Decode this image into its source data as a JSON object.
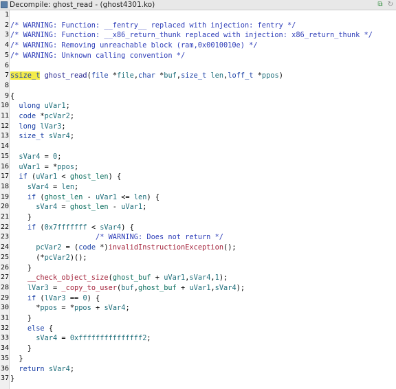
{
  "window": {
    "title": "Decompile: ghost_read -  (ghost4301.ko)"
  },
  "toolbar": {
    "copy_icon": "copy-icon",
    "refresh_icon": "refresh-icon"
  },
  "lines": [
    {
      "n": "1",
      "tokens": []
    },
    {
      "n": "2",
      "tokens": [
        {
          "c": "cm",
          "t": "/* WARNING: Function: __fentry__ replaced with injection: fentry */"
        }
      ]
    },
    {
      "n": "3",
      "tokens": [
        {
          "c": "cm",
          "t": "/* WARNING: Function: __x86_return_thunk replaced with injection: x86_return_thunk */"
        }
      ]
    },
    {
      "n": "4",
      "tokens": [
        {
          "c": "cm",
          "t": "/* WARNING: Removing unreachable block (ram,0x0010010e) */"
        }
      ]
    },
    {
      "n": "5",
      "tokens": [
        {
          "c": "cm",
          "t": "/* WARNING: Unknown calling convention */"
        }
      ]
    },
    {
      "n": "6",
      "tokens": []
    },
    {
      "n": "7",
      "tokens": [
        {
          "c": "tp hl",
          "t": "ssize_t"
        },
        {
          "c": "",
          "t": " "
        },
        {
          "c": "fn",
          "t": "ghost_read"
        },
        {
          "c": "",
          "t": "("
        },
        {
          "c": "tp",
          "t": "file"
        },
        {
          "c": "",
          "t": " *"
        },
        {
          "c": "vr",
          "t": "file"
        },
        {
          "c": "",
          "t": ","
        },
        {
          "c": "tp",
          "t": "char"
        },
        {
          "c": "",
          "t": " *"
        },
        {
          "c": "vr",
          "t": "buf"
        },
        {
          "c": "",
          "t": ","
        },
        {
          "c": "tp",
          "t": "size_t"
        },
        {
          "c": "",
          "t": " "
        },
        {
          "c": "vr",
          "t": "len"
        },
        {
          "c": "",
          "t": ","
        },
        {
          "c": "tp",
          "t": "loff_t"
        },
        {
          "c": "",
          "t": " *"
        },
        {
          "c": "vr",
          "t": "ppos"
        },
        {
          "c": "",
          "t": ")"
        }
      ]
    },
    {
      "n": "8",
      "tokens": []
    },
    {
      "n": "9",
      "tokens": [
        {
          "c": "",
          "t": "{"
        }
      ]
    },
    {
      "n": "10",
      "tokens": [
        {
          "c": "",
          "t": "  "
        },
        {
          "c": "tp",
          "t": "ulong"
        },
        {
          "c": "",
          "t": " "
        },
        {
          "c": "vr",
          "t": "uVar1"
        },
        {
          "c": "",
          "t": ";"
        }
      ]
    },
    {
      "n": "11",
      "tokens": [
        {
          "c": "",
          "t": "  "
        },
        {
          "c": "tp",
          "t": "code"
        },
        {
          "c": "",
          "t": " *"
        },
        {
          "c": "vr",
          "t": "pcVar2"
        },
        {
          "c": "",
          "t": ";"
        }
      ]
    },
    {
      "n": "12",
      "tokens": [
        {
          "c": "",
          "t": "  "
        },
        {
          "c": "tp",
          "t": "long"
        },
        {
          "c": "",
          "t": " "
        },
        {
          "c": "vr",
          "t": "lVar3"
        },
        {
          "c": "",
          "t": ";"
        }
      ]
    },
    {
      "n": "13",
      "tokens": [
        {
          "c": "",
          "t": "  "
        },
        {
          "c": "tp",
          "t": "size_t"
        },
        {
          "c": "",
          "t": " "
        },
        {
          "c": "vr",
          "t": "sVar4"
        },
        {
          "c": "",
          "t": ";"
        }
      ]
    },
    {
      "n": "14",
      "tokens": []
    },
    {
      "n": "15",
      "tokens": [
        {
          "c": "",
          "t": "  "
        },
        {
          "c": "vr",
          "t": "sVar4"
        },
        {
          "c": "",
          "t": " = "
        },
        {
          "c": "nm",
          "t": "0"
        },
        {
          "c": "",
          "t": ";"
        }
      ]
    },
    {
      "n": "16",
      "tokens": [
        {
          "c": "",
          "t": "  "
        },
        {
          "c": "vr",
          "t": "uVar1"
        },
        {
          "c": "",
          "t": " = *"
        },
        {
          "c": "vr",
          "t": "ppos"
        },
        {
          "c": "",
          "t": ";"
        }
      ]
    },
    {
      "n": "17",
      "tokens": [
        {
          "c": "",
          "t": "  "
        },
        {
          "c": "kw",
          "t": "if"
        },
        {
          "c": "",
          "t": " ("
        },
        {
          "c": "vr",
          "t": "uVar1"
        },
        {
          "c": "",
          "t": " < "
        },
        {
          "c": "gl",
          "t": "ghost_len"
        },
        {
          "c": "",
          "t": ") {"
        }
      ]
    },
    {
      "n": "18",
      "tokens": [
        {
          "c": "",
          "t": "    "
        },
        {
          "c": "vr",
          "t": "sVar4"
        },
        {
          "c": "",
          "t": " = "
        },
        {
          "c": "vr",
          "t": "len"
        },
        {
          "c": "",
          "t": ";"
        }
      ]
    },
    {
      "n": "19",
      "tokens": [
        {
          "c": "",
          "t": "    "
        },
        {
          "c": "kw",
          "t": "if"
        },
        {
          "c": "",
          "t": " ("
        },
        {
          "c": "gl",
          "t": "ghost_len"
        },
        {
          "c": "",
          "t": " - "
        },
        {
          "c": "vr",
          "t": "uVar1"
        },
        {
          "c": "",
          "t": " <= "
        },
        {
          "c": "vr",
          "t": "len"
        },
        {
          "c": "",
          "t": ") {"
        }
      ]
    },
    {
      "n": "20",
      "tokens": [
        {
          "c": "",
          "t": "      "
        },
        {
          "c": "vr",
          "t": "sVar4"
        },
        {
          "c": "",
          "t": " = "
        },
        {
          "c": "gl",
          "t": "ghost_len"
        },
        {
          "c": "",
          "t": " - "
        },
        {
          "c": "vr",
          "t": "uVar1"
        },
        {
          "c": "",
          "t": ";"
        }
      ]
    },
    {
      "n": "21",
      "tokens": [
        {
          "c": "",
          "t": "    }"
        }
      ]
    },
    {
      "n": "22",
      "tokens": [
        {
          "c": "",
          "t": "    "
        },
        {
          "c": "kw",
          "t": "if"
        },
        {
          "c": "",
          "t": " ("
        },
        {
          "c": "nm",
          "t": "0x7fffffff"
        },
        {
          "c": "",
          "t": " < "
        },
        {
          "c": "vr",
          "t": "sVar4"
        },
        {
          "c": "",
          "t": ") {"
        }
      ]
    },
    {
      "n": "23",
      "tokens": [
        {
          "c": "",
          "t": "                    "
        },
        {
          "c": "cm",
          "t": "/* WARNING: Does not return */"
        }
      ]
    },
    {
      "n": "24",
      "tokens": [
        {
          "c": "",
          "t": "      "
        },
        {
          "c": "vr",
          "t": "pcVar2"
        },
        {
          "c": "",
          "t": " = ("
        },
        {
          "c": "tp",
          "t": "code"
        },
        {
          "c": "",
          "t": " *)"
        },
        {
          "c": "call",
          "t": "invalidInstructionException"
        },
        {
          "c": "",
          "t": "();"
        }
      ]
    },
    {
      "n": "25",
      "tokens": [
        {
          "c": "",
          "t": "      (*"
        },
        {
          "c": "vr",
          "t": "pcVar2"
        },
        {
          "c": "",
          "t": ")();"
        }
      ]
    },
    {
      "n": "26",
      "tokens": [
        {
          "c": "",
          "t": "    }"
        }
      ]
    },
    {
      "n": "27",
      "tokens": [
        {
          "c": "",
          "t": "    "
        },
        {
          "c": "call",
          "t": "__check_object_size"
        },
        {
          "c": "",
          "t": "("
        },
        {
          "c": "gl",
          "t": "ghost_buf"
        },
        {
          "c": "",
          "t": " + "
        },
        {
          "c": "vr",
          "t": "uVar1"
        },
        {
          "c": "",
          "t": ","
        },
        {
          "c": "vr",
          "t": "sVar4"
        },
        {
          "c": "",
          "t": ","
        },
        {
          "c": "nm",
          "t": "1"
        },
        {
          "c": "",
          "t": ");"
        }
      ]
    },
    {
      "n": "28",
      "tokens": [
        {
          "c": "",
          "t": "    "
        },
        {
          "c": "vr",
          "t": "lVar3"
        },
        {
          "c": "",
          "t": " = "
        },
        {
          "c": "call",
          "t": "_copy_to_user"
        },
        {
          "c": "",
          "t": "("
        },
        {
          "c": "vr",
          "t": "buf"
        },
        {
          "c": "",
          "t": ","
        },
        {
          "c": "gl",
          "t": "ghost_buf"
        },
        {
          "c": "",
          "t": " + "
        },
        {
          "c": "vr",
          "t": "uVar1"
        },
        {
          "c": "",
          "t": ","
        },
        {
          "c": "vr",
          "t": "sVar4"
        },
        {
          "c": "",
          "t": ");"
        }
      ]
    },
    {
      "n": "29",
      "tokens": [
        {
          "c": "",
          "t": "    "
        },
        {
          "c": "kw",
          "t": "if"
        },
        {
          "c": "",
          "t": " ("
        },
        {
          "c": "vr",
          "t": "lVar3"
        },
        {
          "c": "",
          "t": " == "
        },
        {
          "c": "nm",
          "t": "0"
        },
        {
          "c": "",
          "t": ") {"
        }
      ]
    },
    {
      "n": "30",
      "tokens": [
        {
          "c": "",
          "t": "      *"
        },
        {
          "c": "vr",
          "t": "ppos"
        },
        {
          "c": "",
          "t": " = *"
        },
        {
          "c": "vr",
          "t": "ppos"
        },
        {
          "c": "",
          "t": " + "
        },
        {
          "c": "vr",
          "t": "sVar4"
        },
        {
          "c": "",
          "t": ";"
        }
      ]
    },
    {
      "n": "31",
      "tokens": [
        {
          "c": "",
          "t": "    }"
        }
      ]
    },
    {
      "n": "32",
      "tokens": [
        {
          "c": "",
          "t": "    "
        },
        {
          "c": "kw",
          "t": "else"
        },
        {
          "c": "",
          "t": " {"
        }
      ]
    },
    {
      "n": "33",
      "tokens": [
        {
          "c": "",
          "t": "      "
        },
        {
          "c": "vr",
          "t": "sVar4"
        },
        {
          "c": "",
          "t": " = "
        },
        {
          "c": "nm",
          "t": "0xfffffffffffffff2"
        },
        {
          "c": "",
          "t": ";"
        }
      ]
    },
    {
      "n": "34",
      "tokens": [
        {
          "c": "",
          "t": "    }"
        }
      ]
    },
    {
      "n": "35",
      "tokens": [
        {
          "c": "",
          "t": "  }"
        }
      ]
    },
    {
      "n": "36",
      "tokens": [
        {
          "c": "",
          "t": "  "
        },
        {
          "c": "kw",
          "t": "return"
        },
        {
          "c": "",
          "t": " "
        },
        {
          "c": "vr",
          "t": "sVar4"
        },
        {
          "c": "",
          "t": ";"
        }
      ]
    },
    {
      "n": "37",
      "tokens": [
        {
          "c": "",
          "t": "}"
        }
      ]
    }
  ]
}
